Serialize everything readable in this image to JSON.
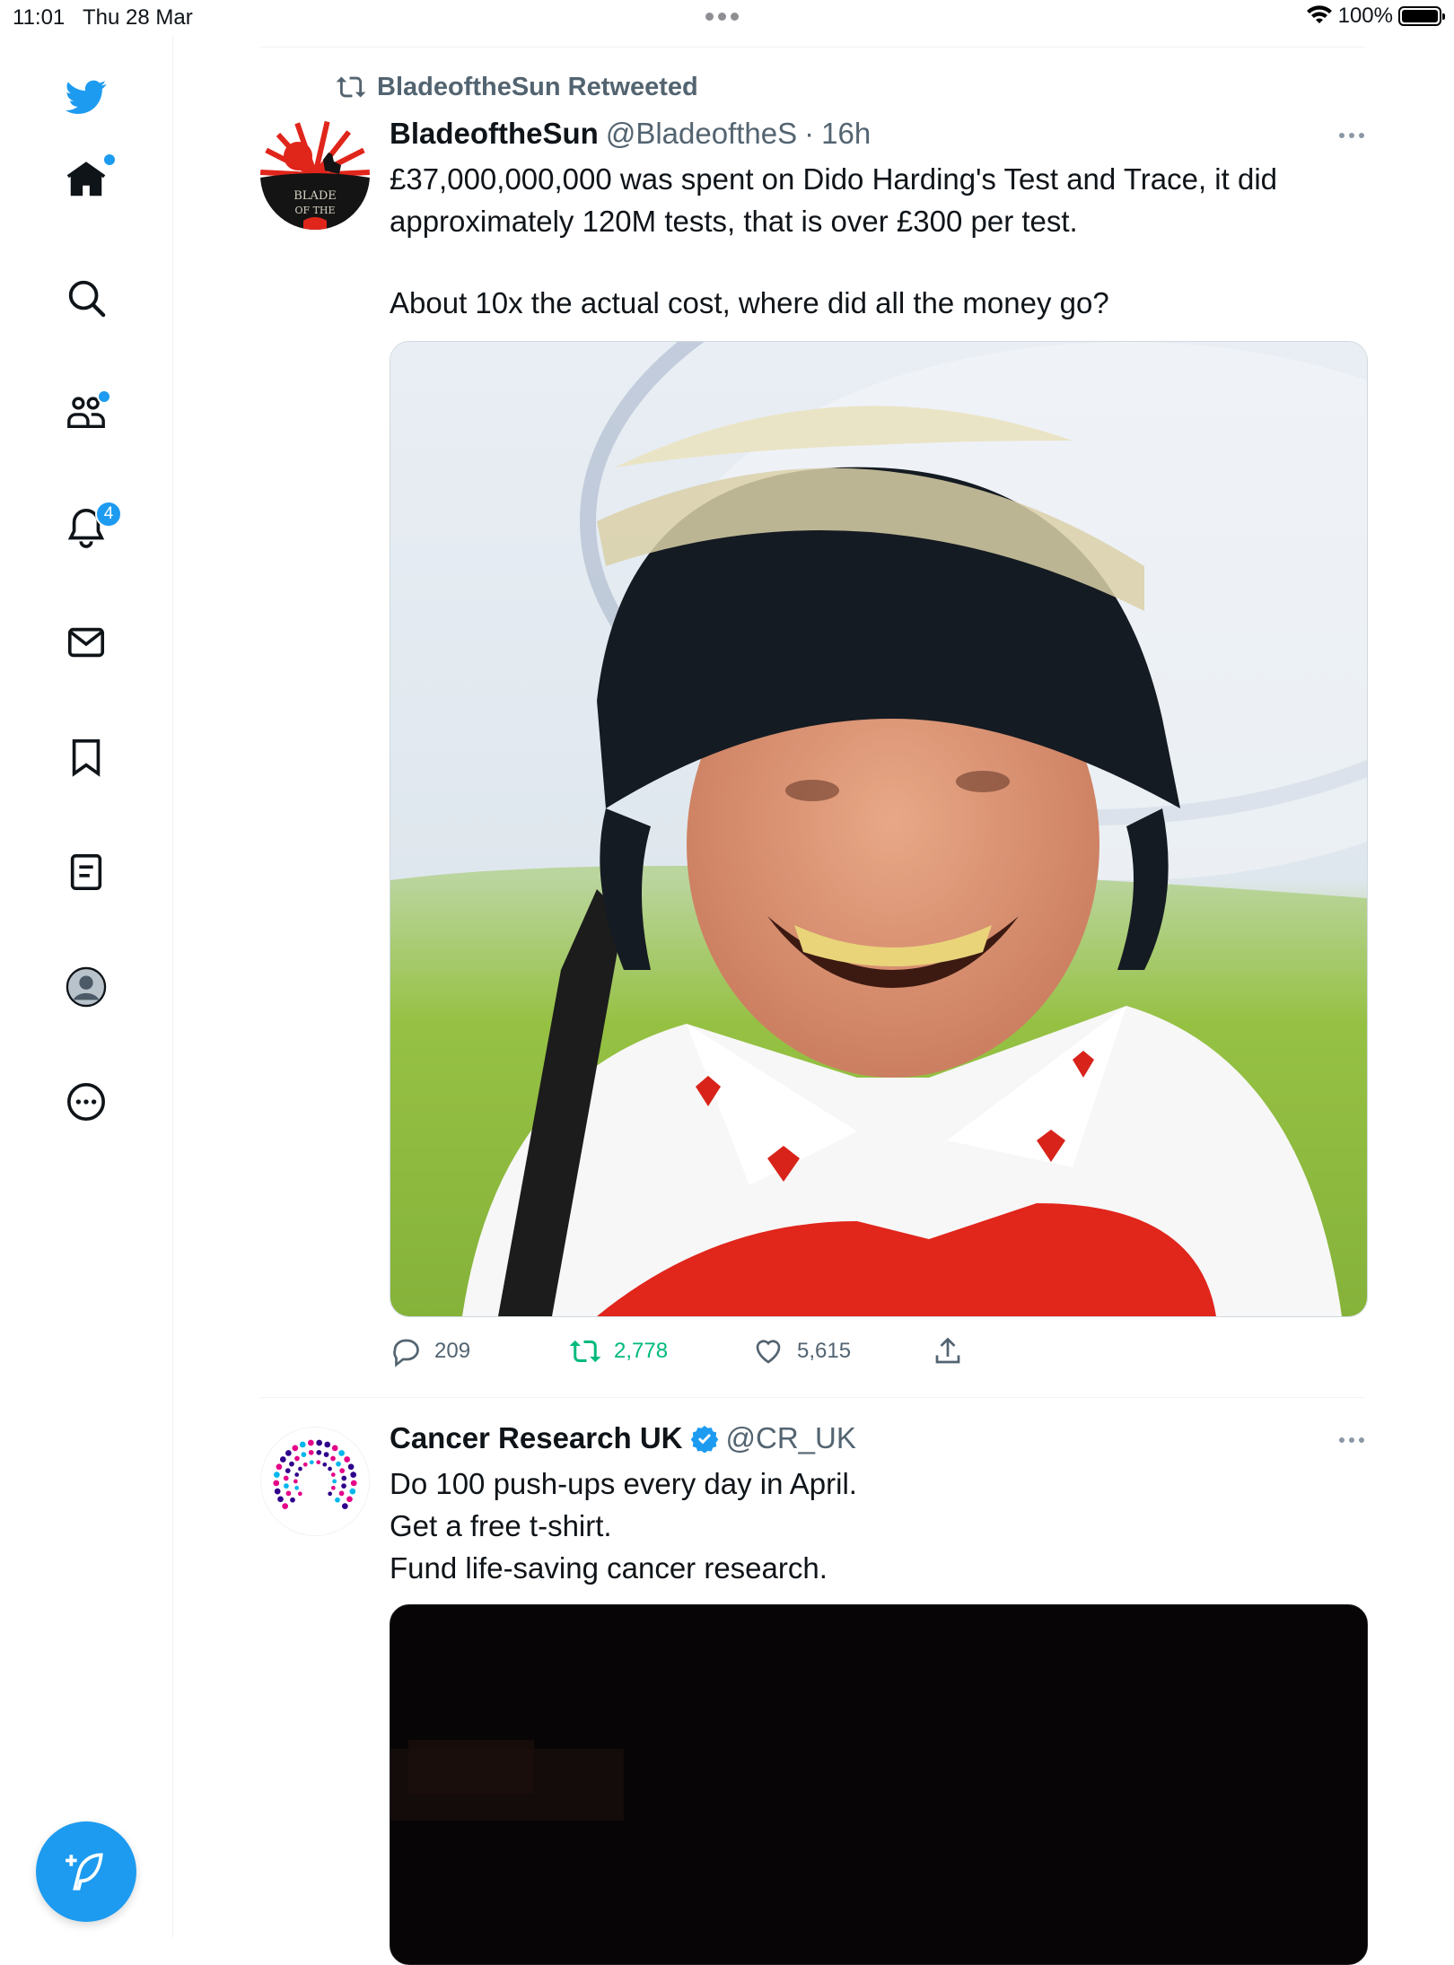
{
  "status_bar": {
    "time": "11:01",
    "date": "Thu 28 Mar",
    "battery": "100%"
  },
  "sidebar": {
    "notifications_badge": "4",
    "items": [
      {
        "name": "home",
        "icon": "home-icon"
      },
      {
        "name": "explore",
        "icon": "search-icon"
      },
      {
        "name": "communities",
        "icon": "communities-icon"
      },
      {
        "name": "notifications",
        "icon": "bell-icon"
      },
      {
        "name": "messages",
        "icon": "envelope-icon"
      },
      {
        "name": "bookmarks",
        "icon": "bookmark-icon"
      },
      {
        "name": "lists",
        "icon": "list-icon"
      },
      {
        "name": "profile",
        "icon": "avatar-icon"
      },
      {
        "name": "more",
        "icon": "more-circle-icon"
      }
    ],
    "accent_color": "#1d9bf0"
  },
  "tweets": [
    {
      "retweeted_by": "BladeoftheSun Retweeted",
      "display_name": "BladeoftheSun",
      "handle": "@BladeoftheS",
      "separator": "·",
      "time": "16h",
      "avatar_text": "BLADE OF THE",
      "text_lines": [
        "£37,000,000,000 was spent on Dido Harding's Test and Trace, it did",
        "approximately 120M tests, that is over £300 per test.",
        "About 10x the actual cost, where did all the money go?"
      ],
      "replies": "209",
      "retweets": "2,778",
      "likes": "5,615"
    },
    {
      "display_name": "Cancer Research UK",
      "handle": "@CR_UK",
      "verified": true,
      "text_lines": [
        "Do 100 push-ups every day in April.",
        "Get a free t-shirt.",
        "Fund life-saving cancer research."
      ]
    }
  ]
}
